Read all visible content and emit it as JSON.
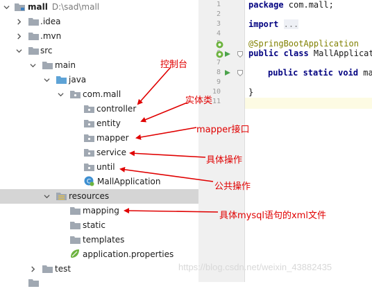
{
  "project": {
    "name": "mall",
    "path": "D:\\sad\\mall"
  },
  "tree": {
    "idea": ".idea",
    "mvn": ".mvn",
    "src": "src",
    "main": "main",
    "java": "java",
    "package": "com.mall",
    "controller": "controller",
    "entity": "entity",
    "mapper": "mapper",
    "service": "service",
    "until": "until",
    "app_class": "MallApplication",
    "resources": "resources",
    "mapping": "mapping",
    "static": "static",
    "templates": "templates",
    "app_properties": "application.properties",
    "test": "test"
  },
  "editor": {
    "line_numbers": [
      "1",
      "2",
      "3",
      "4",
      "5",
      "6",
      "7",
      "8",
      "9",
      "10",
      "11"
    ],
    "line1_kw": "package",
    "line1_rest": " com.mall;",
    "line3_kw": "import",
    "line3_fold": "...",
    "line6_annotation": "@SpringBootApplication",
    "line7_kw": "public class",
    "line7_rest": " MallApplicati",
    "line9_kw": "public static void",
    "line9_rest": " mai",
    "line11": "}"
  },
  "annotations": {
    "controller_note": "控制台",
    "entity_note": "实体类",
    "mapper_note": "mapper接口",
    "service_note": "具体操作",
    "until_note": "公共操作",
    "mapping_note": "具体mysql语句的xml文件"
  },
  "watermark": "https://blog.csdn.net/weixin_43882435",
  "colors": {
    "annotation_red": "#e00000",
    "folder_gray": "#a0a8b2",
    "source_folder_blue": "#5ea3d6",
    "selection": "#d5d5d5"
  }
}
